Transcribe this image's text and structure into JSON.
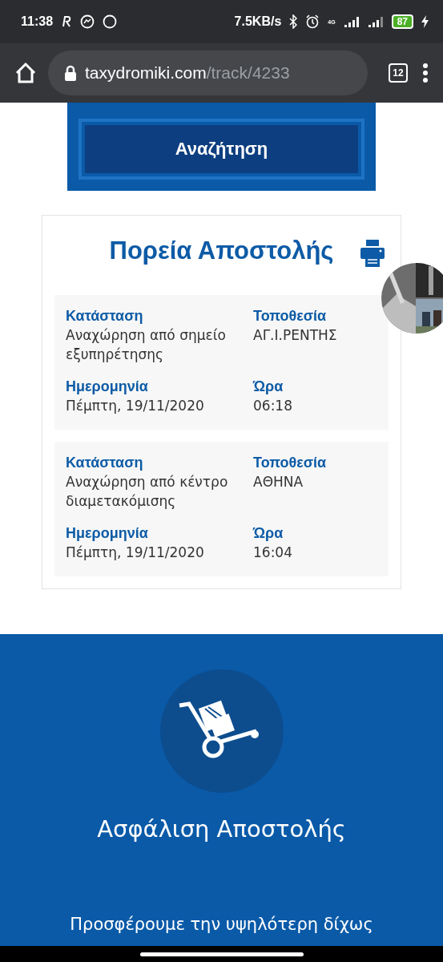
{
  "status_bar": {
    "time": "11:38",
    "speed": "7.5KB/s",
    "network": "4G",
    "battery": "87"
  },
  "browser": {
    "url_host": "taxydromiki.com",
    "url_path": "/track/4233",
    "tab_count": "12"
  },
  "search": {
    "button": "Αναζήτηση"
  },
  "tracking": {
    "title": "Πορεία Αποστολής",
    "entries": [
      {
        "status_label": "Κατάσταση",
        "status": "Αναχώρηση από σημείο εξυπηρέτησης",
        "location_label": "Τοποθεσία",
        "location": "ΑΓ.Ι.ΡΕΝΤΗΣ",
        "date_label": "Ημερομηνία",
        "date": "Πέμπτη, 19/11/2020",
        "time_label": "Ώρα",
        "time": "06:18"
      },
      {
        "status_label": "Κατάσταση",
        "status": "Αναχώρηση από κέντρο διαμετακόμισης",
        "location_label": "Τοποθεσία",
        "location": "ΑΘΗΝΑ",
        "date_label": "Ημερομηνία",
        "date": "Πέμπτη, 19/11/2020",
        "time_label": "Ώρα",
        "time": "16:04"
      }
    ]
  },
  "insurance": {
    "title": "Ασφάλιση Αποστολής",
    "text": "Προσφέρουμε την υψηλότερη δίχως"
  }
}
